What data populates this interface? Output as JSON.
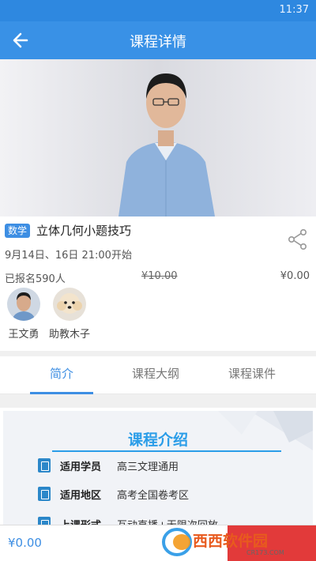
{
  "status_bar": {
    "time": "11:37"
  },
  "app_bar": {
    "title": "课程详情"
  },
  "course": {
    "subject_badge": "数学",
    "title": "立体几何小题技巧",
    "schedule": "9月14日、16日 21:00开始",
    "enrolled": "已报名590人",
    "original_price": "¥10.00",
    "price": "¥0.00"
  },
  "teachers": [
    {
      "name": "王文勇"
    },
    {
      "name": "助教木子"
    }
  ],
  "tabs": [
    {
      "label": "简介",
      "active": true
    },
    {
      "label": "课程大纲",
      "active": false
    },
    {
      "label": "课程课件",
      "active": false
    }
  ],
  "intro": {
    "heading": "课程介绍",
    "rows": [
      {
        "label": "适用学员",
        "value": "高三文理通用"
      },
      {
        "label": "适用地区",
        "value": "高考全国卷考区"
      },
      {
        "label": "上课形式",
        "value": "互动直播+无限次回放"
      }
    ]
  },
  "bottom_bar": {
    "price": "¥0.00"
  },
  "watermark": {
    "text_main": "西西软件园",
    "text_sub": "CR173.COM"
  },
  "colors": {
    "primary": "#3991e6",
    "accent_blue": "#3d8ee3",
    "buy_red": "#e23a3a"
  }
}
